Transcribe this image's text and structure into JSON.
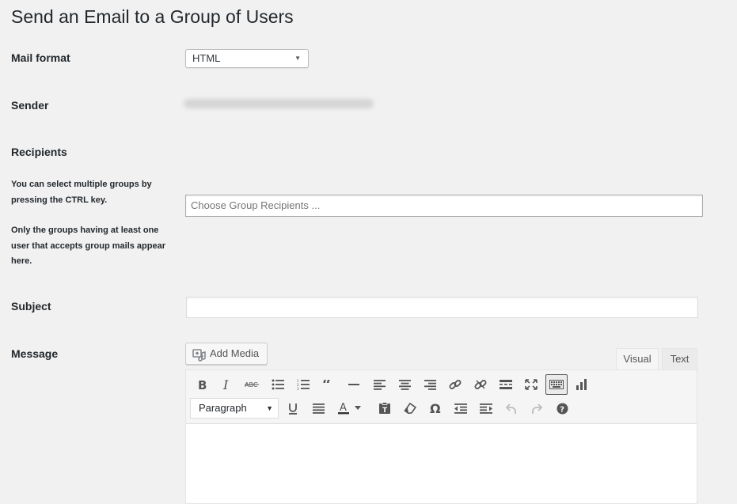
{
  "page": {
    "title": "Send an Email to a Group of Users"
  },
  "mail_format": {
    "label": "Mail format",
    "selected": "HTML"
  },
  "sender": {
    "label": "Sender"
  },
  "recipients": {
    "label": "Recipients",
    "help_1": "You can select multiple groups by pressing the CTRL key.",
    "help_2": "Only the groups having at least one user that accepts group mails appear here.",
    "placeholder": "Choose Group Recipients ..."
  },
  "subject": {
    "label": "Subject",
    "value": ""
  },
  "message": {
    "label": "Message",
    "add_media_label": "Add Media",
    "tabs": {
      "visual": "Visual",
      "text": "Text"
    },
    "format_selected": "Paragraph",
    "toolbar_row1": [
      "bold-icon",
      "italic-icon",
      "strikethrough-icon",
      "bullet-list-icon",
      "numbered-list-icon",
      "blockquote-icon",
      "horizontal-line-icon",
      "align-left-icon",
      "align-center-icon",
      "align-right-icon",
      "link-icon",
      "unlink-icon",
      "read-more-icon",
      "fullscreen-icon",
      "toolbar-toggle-icon",
      "chart-icon"
    ],
    "toolbar_row2": [
      "underline-icon",
      "justify-icon",
      "text-color-icon",
      "paste-text-icon",
      "clear-formatting-icon",
      "special-character-icon",
      "outdent-icon",
      "indent-icon",
      "undo-icon",
      "redo-icon",
      "help-icon"
    ]
  },
  "colors": {
    "background": "#f1f1f1",
    "text": "#23282d",
    "toolbar": "#f5f5f5"
  }
}
